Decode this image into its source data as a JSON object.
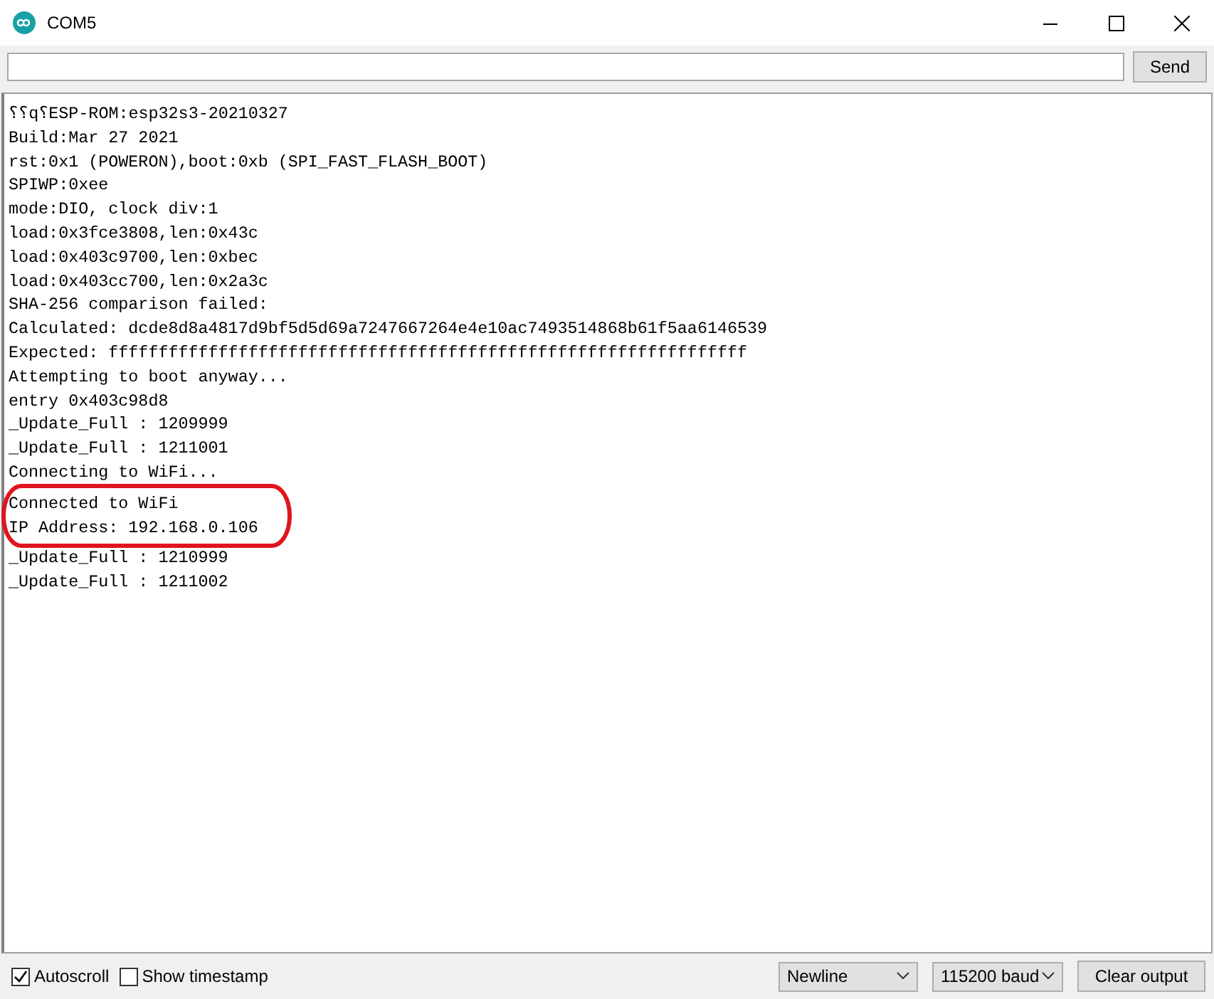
{
  "window": {
    "title": "COM5"
  },
  "send_bar": {
    "button": "Send"
  },
  "output": {
    "lines": [
      {
        "text": "⸮⸮q⸮ESP-ROM:esp32s3-20210327",
        "circled": false
      },
      {
        "text": "Build:Mar 27 2021",
        "circled": false
      },
      {
        "text": "rst:0x1 (POWERON),boot:0xb (SPI_FAST_FLASH_BOOT)",
        "circled": false
      },
      {
        "text": "SPIWP:0xee",
        "circled": false
      },
      {
        "text": "mode:DIO, clock div:1",
        "circled": false
      },
      {
        "text": "load:0x3fce3808,len:0x43c",
        "circled": false
      },
      {
        "text": "load:0x403c9700,len:0xbec",
        "circled": false
      },
      {
        "text": "load:0x403cc700,len:0x2a3c",
        "circled": false
      },
      {
        "text": "SHA-256 comparison failed:",
        "circled": false
      },
      {
        "text": "Calculated: dcde8d8a4817d9bf5d5d69a7247667264e4e10ac7493514868b61f5aa6146539",
        "circled": false
      },
      {
        "text": "Expected: ffffffffffffffffffffffffffffffffffffffffffffffffffffffffffffffff",
        "circled": false
      },
      {
        "text": "Attempting to boot anyway...",
        "circled": false
      },
      {
        "text": "entry 0x403c98d8",
        "circled": false
      },
      {
        "text": "_Update_Full : 1209999",
        "circled": false
      },
      {
        "text": "_Update_Full : 1211001",
        "circled": false
      },
      {
        "text": "Connecting to WiFi...",
        "circled": false
      },
      {
        "text": "Connected to WiFi",
        "circled": true
      },
      {
        "text": "IP Address: 192.168.0.106",
        "circled": true
      },
      {
        "text": "_Update_Full : 1210999",
        "circled": false
      },
      {
        "text": "_Update_Full : 1211002",
        "circled": false
      }
    ]
  },
  "status_bar": {
    "autoscroll": {
      "label": "Autoscroll",
      "checked": true
    },
    "timestamp": {
      "label": "Show timestamp",
      "checked": false
    },
    "line_ending": "Newline",
    "baud": "115200 baud",
    "clear_button": "Clear output"
  }
}
